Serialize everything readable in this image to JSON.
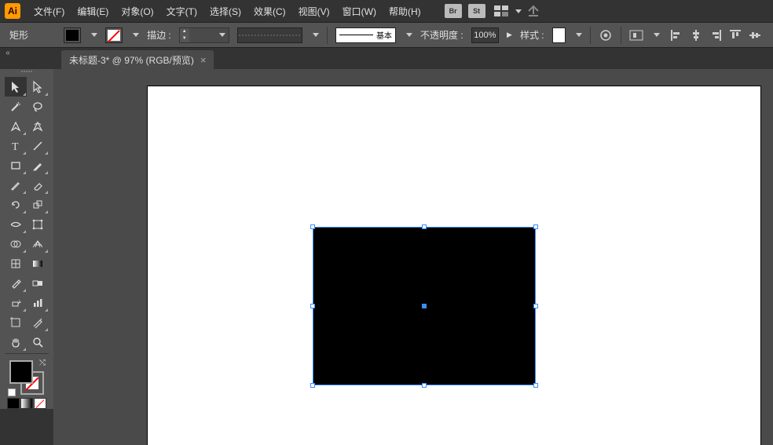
{
  "app": {
    "logo": "Ai"
  },
  "menu": {
    "items": [
      "文件(F)",
      "编辑(E)",
      "对象(O)",
      "文字(T)",
      "选择(S)",
      "效果(C)",
      "视图(V)",
      "窗口(W)",
      "帮助(H)"
    ],
    "badges": [
      "Br",
      "St"
    ]
  },
  "controlbar": {
    "shape_label": "矩形",
    "stroke_label": "描边 :",
    "stroke_weight": "",
    "brush_label": "基本",
    "opacity_label": "不透明度 :",
    "opacity_value": "100%",
    "style_label": "样式 :"
  },
  "tab": {
    "title": "未标题-3* @ 97% (RGB/预览)",
    "close": "×"
  },
  "colors": {
    "fill": "#000000",
    "stroke": "none",
    "selection": "#3b8cff"
  }
}
